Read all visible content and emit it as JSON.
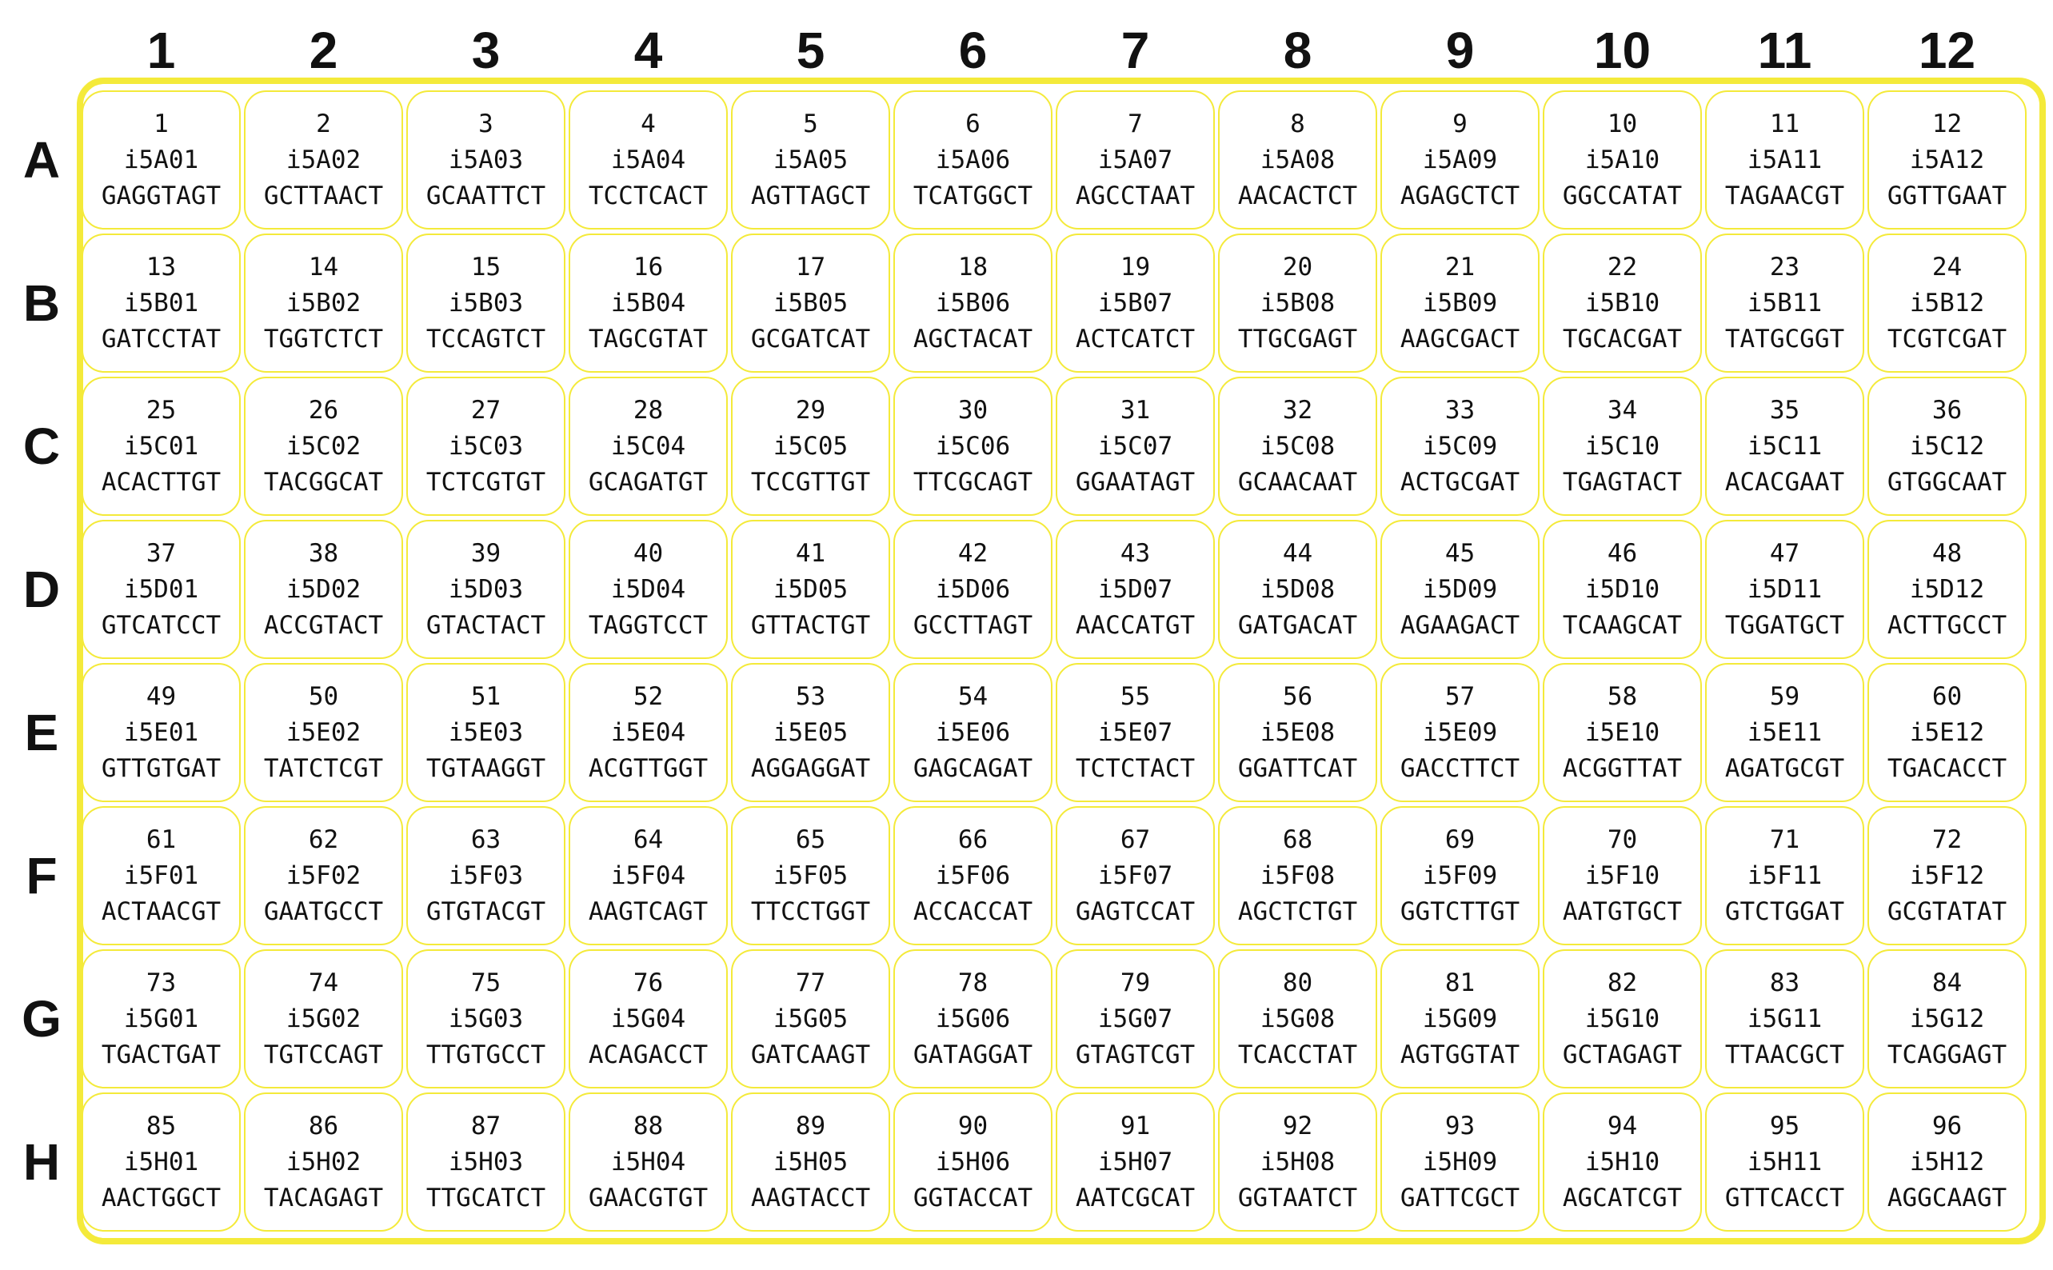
{
  "columns": [
    "1",
    "2",
    "3",
    "4",
    "5",
    "6",
    "7",
    "8",
    "9",
    "10",
    "11",
    "12"
  ],
  "rows": [
    "A",
    "B",
    "C",
    "D",
    "E",
    "F",
    "G",
    "H"
  ],
  "plate_border_color": "#f4ea3a",
  "wells": [
    {
      "number": "1",
      "name": "i5A01",
      "seq": "GAGGTAGT"
    },
    {
      "number": "2",
      "name": "i5A02",
      "seq": "GCTTAACT"
    },
    {
      "number": "3",
      "name": "i5A03",
      "seq": "GCAATTCT"
    },
    {
      "number": "4",
      "name": "i5A04",
      "seq": "TCCTCACT"
    },
    {
      "number": "5",
      "name": "i5A05",
      "seq": "AGTTAGCT"
    },
    {
      "number": "6",
      "name": "i5A06",
      "seq": "TCATGGCT"
    },
    {
      "number": "7",
      "name": "i5A07",
      "seq": "AGCCTAAT"
    },
    {
      "number": "8",
      "name": "i5A08",
      "seq": "AACACTCT"
    },
    {
      "number": "9",
      "name": "i5A09",
      "seq": "AGAGCTCT"
    },
    {
      "number": "10",
      "name": "i5A10",
      "seq": "GGCCATAT"
    },
    {
      "number": "11",
      "name": "i5A11",
      "seq": "TAGAACGT"
    },
    {
      "number": "12",
      "name": "i5A12",
      "seq": "GGTTGAAT"
    },
    {
      "number": "13",
      "name": "i5B01",
      "seq": "GATCCTAT"
    },
    {
      "number": "14",
      "name": "i5B02",
      "seq": "TGGTCTCT"
    },
    {
      "number": "15",
      "name": "i5B03",
      "seq": "TCCAGTCT"
    },
    {
      "number": "16",
      "name": "i5B04",
      "seq": "TAGCGTAT"
    },
    {
      "number": "17",
      "name": "i5B05",
      "seq": "GCGATCAT"
    },
    {
      "number": "18",
      "name": "i5B06",
      "seq": "AGCTACAT"
    },
    {
      "number": "19",
      "name": "i5B07",
      "seq": "ACTCATCT"
    },
    {
      "number": "20",
      "name": "i5B08",
      "seq": "TTGCGAGT"
    },
    {
      "number": "21",
      "name": "i5B09",
      "seq": "AAGCGACT"
    },
    {
      "number": "22",
      "name": "i5B10",
      "seq": "TGCACGAT"
    },
    {
      "number": "23",
      "name": "i5B11",
      "seq": "TATGCGGT"
    },
    {
      "number": "24",
      "name": "i5B12",
      "seq": "TCGTCGAT"
    },
    {
      "number": "25",
      "name": "i5C01",
      "seq": "ACACTTGT"
    },
    {
      "number": "26",
      "name": "i5C02",
      "seq": "TACGGCAT"
    },
    {
      "number": "27",
      "name": "i5C03",
      "seq": "TCTCGTGT"
    },
    {
      "number": "28",
      "name": "i5C04",
      "seq": "GCAGATGT"
    },
    {
      "number": "29",
      "name": "i5C05",
      "seq": "TCCGTTGT"
    },
    {
      "number": "30",
      "name": "i5C06",
      "seq": "TTCGCAGT"
    },
    {
      "number": "31",
      "name": "i5C07",
      "seq": "GGAATAGT"
    },
    {
      "number": "32",
      "name": "i5C08",
      "seq": "GCAACAAT"
    },
    {
      "number": "33",
      "name": "i5C09",
      "seq": "ACTGCGAT"
    },
    {
      "number": "34",
      "name": "i5C10",
      "seq": "TGAGTACT"
    },
    {
      "number": "35",
      "name": "i5C11",
      "seq": "ACACGAAT"
    },
    {
      "number": "36",
      "name": "i5C12",
      "seq": "GTGGCAAT"
    },
    {
      "number": "37",
      "name": "i5D01",
      "seq": "GTCATCCT"
    },
    {
      "number": "38",
      "name": "i5D02",
      "seq": "ACCGTACT"
    },
    {
      "number": "39",
      "name": "i5D03",
      "seq": "GTACTACT"
    },
    {
      "number": "40",
      "name": "i5D04",
      "seq": "TAGGTCCT"
    },
    {
      "number": "41",
      "name": "i5D05",
      "seq": "GTTACTGT"
    },
    {
      "number": "42",
      "name": "i5D06",
      "seq": "GCCTTAGT"
    },
    {
      "number": "43",
      "name": "i5D07",
      "seq": "AACCATGT"
    },
    {
      "number": "44",
      "name": "i5D08",
      "seq": "GATGACAT"
    },
    {
      "number": "45",
      "name": "i5D09",
      "seq": "AGAAGACT"
    },
    {
      "number": "46",
      "name": "i5D10",
      "seq": "TCAAGCAT"
    },
    {
      "number": "47",
      "name": "i5D11",
      "seq": "TGGATGCT"
    },
    {
      "number": "48",
      "name": "i5D12",
      "seq": "ACTTGCCT"
    },
    {
      "number": "49",
      "name": "i5E01",
      "seq": "GTTGTGAT"
    },
    {
      "number": "50",
      "name": "i5E02",
      "seq": "TATCTCGT"
    },
    {
      "number": "51",
      "name": "i5E03",
      "seq": "TGTAAGGT"
    },
    {
      "number": "52",
      "name": "i5E04",
      "seq": "ACGTTGGT"
    },
    {
      "number": "53",
      "name": "i5E05",
      "seq": "AGGAGGAT"
    },
    {
      "number": "54",
      "name": "i5E06",
      "seq": "GAGCAGAT"
    },
    {
      "number": "55",
      "name": "i5E07",
      "seq": "TCTCTACT"
    },
    {
      "number": "56",
      "name": "i5E08",
      "seq": "GGATTCAT"
    },
    {
      "number": "57",
      "name": "i5E09",
      "seq": "GACCTTCT"
    },
    {
      "number": "58",
      "name": "i5E10",
      "seq": "ACGGTTAT"
    },
    {
      "number": "59",
      "name": "i5E11",
      "seq": "AGATGCGT"
    },
    {
      "number": "60",
      "name": "i5E12",
      "seq": "TGACACCT"
    },
    {
      "number": "61",
      "name": "i5F01",
      "seq": "ACTAACGT"
    },
    {
      "number": "62",
      "name": "i5F02",
      "seq": "GAATGCCT"
    },
    {
      "number": "63",
      "name": "i5F03",
      "seq": "GTGTACGT"
    },
    {
      "number": "64",
      "name": "i5F04",
      "seq": "AAGTCAGT"
    },
    {
      "number": "65",
      "name": "i5F05",
      "seq": "TTCCTGGT"
    },
    {
      "number": "66",
      "name": "i5F06",
      "seq": "ACCACCAT"
    },
    {
      "number": "67",
      "name": "i5F07",
      "seq": "GAGTCCAT"
    },
    {
      "number": "68",
      "name": "i5F08",
      "seq": "AGCTCTGT"
    },
    {
      "number": "69",
      "name": "i5F09",
      "seq": "GGTCTTGT"
    },
    {
      "number": "70",
      "name": "i5F10",
      "seq": "AATGTGCT"
    },
    {
      "number": "71",
      "name": "i5F11",
      "seq": "GTCTGGAT"
    },
    {
      "number": "72",
      "name": "i5F12",
      "seq": "GCGTATAT"
    },
    {
      "number": "73",
      "name": "i5G01",
      "seq": "TGACTGAT"
    },
    {
      "number": "74",
      "name": "i5G02",
      "seq": "TGTCCAGT"
    },
    {
      "number": "75",
      "name": "i5G03",
      "seq": "TTGTGCCT"
    },
    {
      "number": "76",
      "name": "i5G04",
      "seq": "ACAGACCT"
    },
    {
      "number": "77",
      "name": "i5G05",
      "seq": "GATCAAGT"
    },
    {
      "number": "78",
      "name": "i5G06",
      "seq": "GATAGGAT"
    },
    {
      "number": "79",
      "name": "i5G07",
      "seq": "GTAGTCGT"
    },
    {
      "number": "80",
      "name": "i5G08",
      "seq": "TCACCTAT"
    },
    {
      "number": "81",
      "name": "i5G09",
      "seq": "AGTGGTAT"
    },
    {
      "number": "82",
      "name": "i5G10",
      "seq": "GCTAGAGT"
    },
    {
      "number": "83",
      "name": "i5G11",
      "seq": "TTAACGCT"
    },
    {
      "number": "84",
      "name": "i5G12",
      "seq": "TCAGGAGT"
    },
    {
      "number": "85",
      "name": "i5H01",
      "seq": "AACTGGCT"
    },
    {
      "number": "86",
      "name": "i5H02",
      "seq": "TACAGAGT"
    },
    {
      "number": "87",
      "name": "i5H03",
      "seq": "TTGCATCT"
    },
    {
      "number": "88",
      "name": "i5H04",
      "seq": "GAACGTGT"
    },
    {
      "number": "89",
      "name": "i5H05",
      "seq": "AAGTACCT"
    },
    {
      "number": "90",
      "name": "i5H06",
      "seq": "GGTACCAT"
    },
    {
      "number": "91",
      "name": "i5H07",
      "seq": "AATCGCAT"
    },
    {
      "number": "92",
      "name": "i5H08",
      "seq": "GGTAATCT"
    },
    {
      "number": "93",
      "name": "i5H09",
      "seq": "GATTCGCT"
    },
    {
      "number": "94",
      "name": "i5H10",
      "seq": "AGCATCGT"
    },
    {
      "number": "95",
      "name": "i5H11",
      "seq": "GTTCACCT"
    },
    {
      "number": "96",
      "name": "i5H12",
      "seq": "AGGCAAGT"
    }
  ]
}
